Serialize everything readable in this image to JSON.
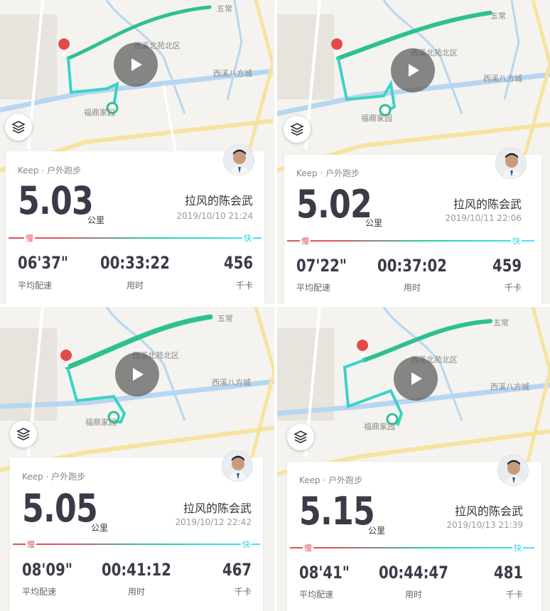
{
  "panels": [
    {
      "app": "Keep · 户外跑步",
      "distance": "5.03",
      "unit": "公里",
      "user": "拉风的陈会武",
      "datetime": "2019/10/10 21:24",
      "pace_label_slow": "慢",
      "pace_label_fast": "快",
      "pace": "06'37\"",
      "pace_label": "平均配速",
      "duration": "00:33:22",
      "duration_label": "用时",
      "calories": "456",
      "calories_label": "千卡",
      "map": {
        "place1": "五常",
        "place2": "西溪北苑北区",
        "place3": "西溪八方城",
        "place4": "福鼎家园"
      }
    },
    {
      "app": "Keep · 户外跑步",
      "distance": "5.02",
      "unit": "公里",
      "user": "拉风的陈会武",
      "datetime": "2019/10/11 22:06",
      "pace_label_slow": "慢",
      "pace_label_fast": "快",
      "pace": "07'22\"",
      "pace_label": "平均配速",
      "duration": "00:37:02",
      "duration_label": "用时",
      "calories": "459",
      "calories_label": "千卡",
      "map": {
        "place1": "五常",
        "place2": "西溪北苑北区",
        "place3": "西溪八方城",
        "place4": "福鼎家园"
      }
    },
    {
      "app": "Keep · 户外跑步",
      "distance": "5.05",
      "unit": "公里",
      "user": "拉风的陈会武",
      "datetime": "2019/10/12 22:42",
      "pace_label_slow": "慢",
      "pace_label_fast": "快",
      "pace": "08'09\"",
      "pace_label": "平均配速",
      "duration": "00:41:12",
      "duration_label": "用时",
      "calories": "467",
      "calories_label": "千卡",
      "map": {
        "place1": "五常",
        "place2": "西溪北苑北区",
        "place3": "西溪八方城",
        "place4": "福鼎家园"
      }
    },
    {
      "app": "Keep · 户外跑步",
      "distance": "5.15",
      "unit": "公里",
      "user": "拉风的陈会武",
      "datetime": "2019/10/13 21:39",
      "pace_label_slow": "慢",
      "pace_label_fast": "快",
      "pace": "08'41\"",
      "pace_label": "平均配速",
      "duration": "00:44:47",
      "duration_label": "用时",
      "calories": "481",
      "calories_label": "千卡",
      "map": {
        "place1": "五常",
        "place2": "西溪北苑北区",
        "place3": "西溪八方城",
        "place4": "福鼎家园"
      }
    }
  ]
}
